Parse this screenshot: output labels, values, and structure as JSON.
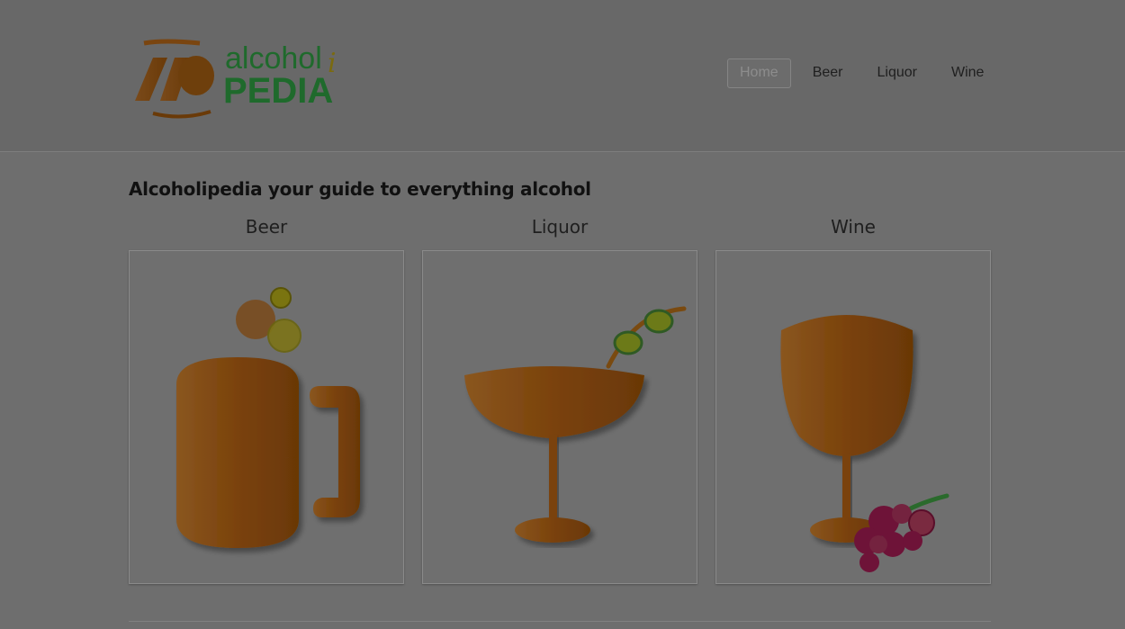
{
  "logo": {
    "word1": "alcohol",
    "word2": "PEDIA",
    "mark": "AP",
    "accent": "i"
  },
  "nav": {
    "items": [
      {
        "label": "Home",
        "active": true
      },
      {
        "label": "Beer",
        "active": false
      },
      {
        "label": "Liquor",
        "active": false
      },
      {
        "label": "Wine",
        "active": false
      }
    ]
  },
  "main": {
    "heading": "Alcoholipedia your guide to everything alcohol",
    "categories": [
      {
        "label": "Beer",
        "icon": "beer-mug-icon"
      },
      {
        "label": "Liquor",
        "icon": "cocktail-glass-icon"
      },
      {
        "label": "Wine",
        "icon": "wine-glass-icon"
      }
    ]
  },
  "colors": {
    "amber": "#8a4f10",
    "logo_green": "#1f6a2c",
    "olive": "#6d7a14",
    "grape": "#6e1338"
  }
}
